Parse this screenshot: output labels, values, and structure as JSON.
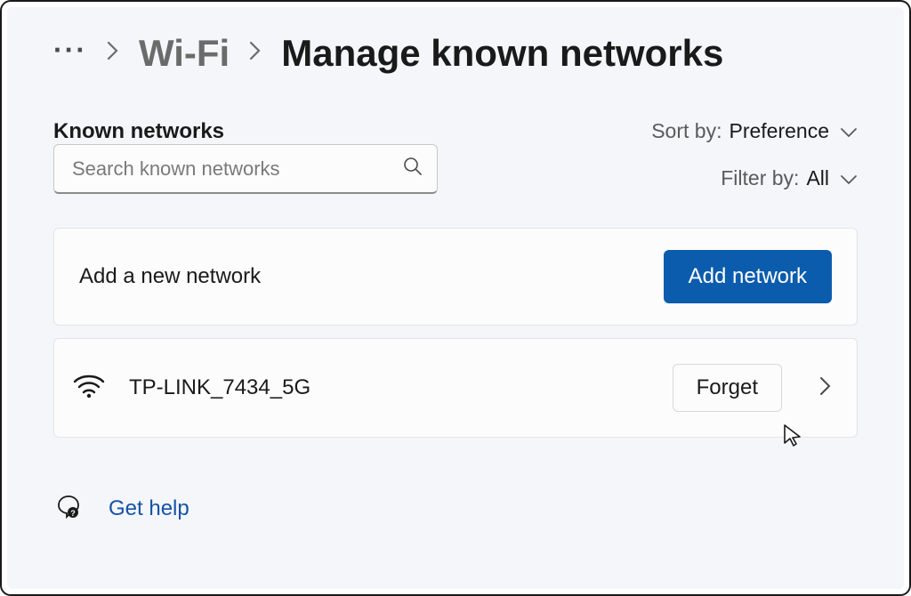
{
  "breadcrumb": {
    "dots": "···",
    "parent": "Wi-Fi",
    "title": "Manage known networks"
  },
  "section": {
    "title": "Known networks"
  },
  "search": {
    "placeholder": "Search known networks"
  },
  "sort": {
    "label": "Sort by:",
    "value": "Preference"
  },
  "filter": {
    "label": "Filter by:",
    "value": "All"
  },
  "addCard": {
    "label": "Add a new network",
    "button": "Add network"
  },
  "networks": [
    {
      "name": "TP-LINK_7434_5G",
      "forget": "Forget"
    }
  ],
  "help": {
    "label": "Get help"
  }
}
